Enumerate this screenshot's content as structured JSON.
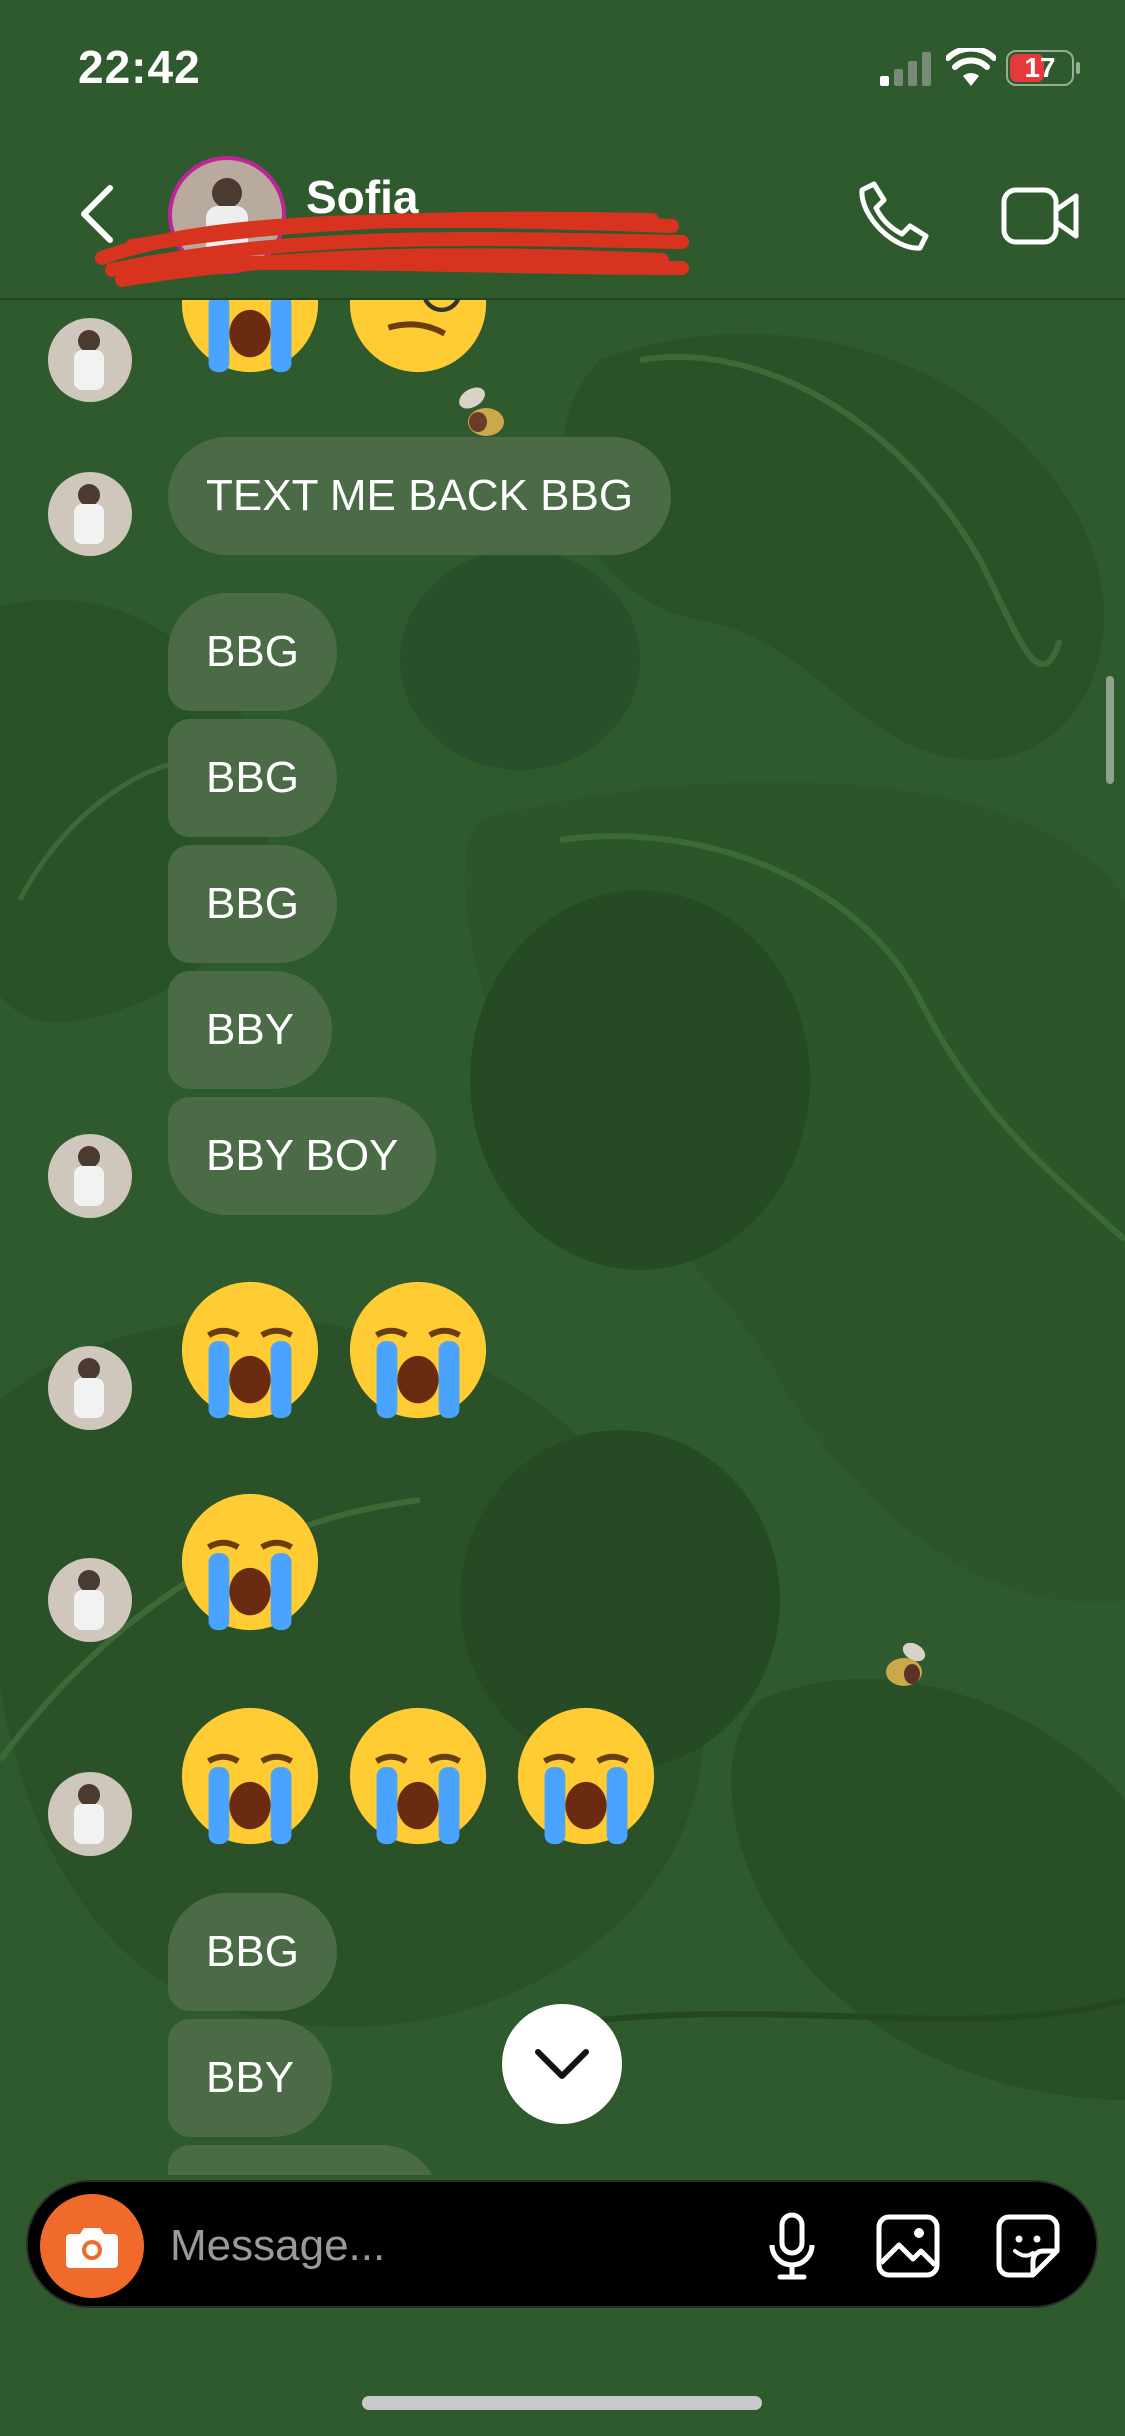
{
  "status_bar": {
    "time": "22:42",
    "battery": "17"
  },
  "header": {
    "contact_name": "Sofia"
  },
  "messages": {
    "text_me_back": "TEXT ME BACK BBG",
    "bbg_1": "BBG",
    "bbg_2": "BBG",
    "bbg_3": "BBG",
    "bby_1": "BBY",
    "bby_boy": "BBY BOY",
    "bbg_4": "BBG",
    "bby_2": "BBY"
  },
  "composer": {
    "placeholder": "Message..."
  },
  "colors": {
    "background": "#2f5a2d",
    "bubble": "#4b6b47",
    "camera_button": "#f06a2b",
    "battery_low": "#e5393b"
  },
  "icons": [
    "back-chevron-icon",
    "phone-icon",
    "video-camera-icon",
    "camera-icon",
    "microphone-icon",
    "gallery-icon",
    "sticker-icon",
    "chevron-down-icon"
  ]
}
